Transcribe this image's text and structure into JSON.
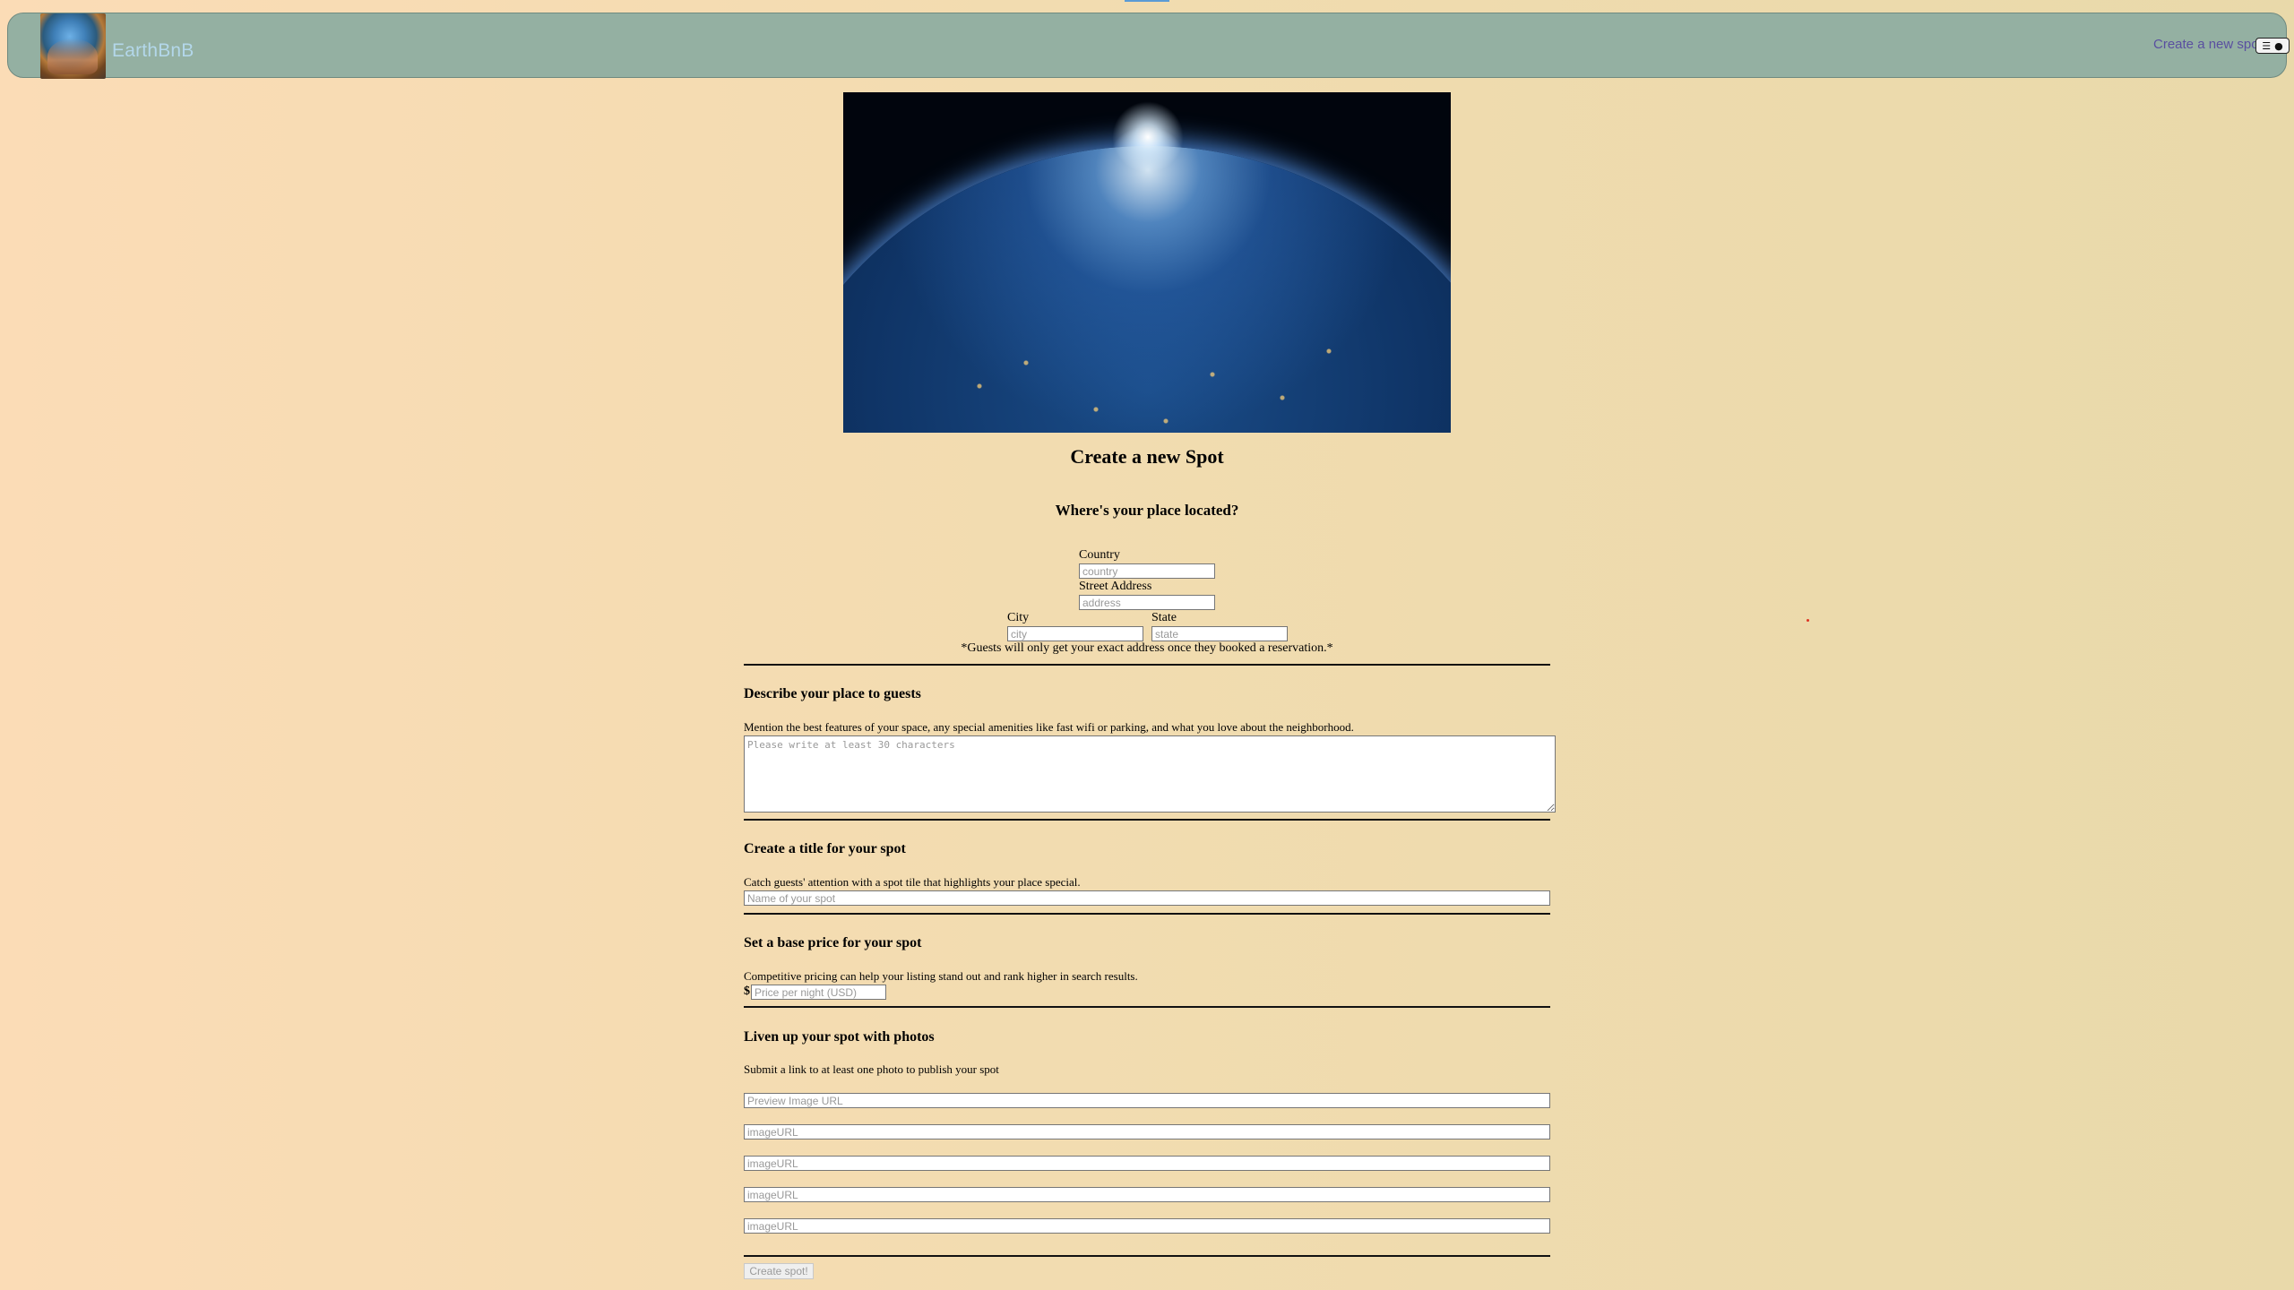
{
  "navbar": {
    "brand": "EarthBnB",
    "create_link": "Create a new spot",
    "menu_icon": "hamburger-icon",
    "user_icon": "user-circle-icon"
  },
  "form": {
    "title": "Create a new Spot",
    "location": {
      "heading": "Where's your place located?",
      "country_label": "Country",
      "country_placeholder": "country",
      "address_label": "Street Address",
      "address_placeholder": "address",
      "city_label": "City",
      "city_placeholder": "city",
      "state_label": "State",
      "state_placeholder": "state",
      "note": "*Guests will only get your exact address once they booked a reservation.*"
    },
    "description": {
      "heading": "Describe your place to guests",
      "text": "Mention the best features of your space, any special amenities like fast wifi or parking, and what you love about the neighborhood.",
      "placeholder": "Please write at least 30 characters"
    },
    "title_section": {
      "heading": "Create a title for your spot",
      "text": "Catch guests' attention with a spot tile that highlights your place special.",
      "placeholder": "Name of your spot"
    },
    "price": {
      "heading": "Set a base price for your spot",
      "text": "Competitive pricing can help your listing stand out and rank higher in search results.",
      "currency_symbol": "$",
      "placeholder": "Price per night (USD)"
    },
    "photos": {
      "heading": "Liven up your spot with photos",
      "text": "Submit a link to at least one photo to publish your spot",
      "preview_placeholder": "Preview Image URL",
      "image_placeholder_1": "imageURL",
      "image_placeholder_2": "imageURL",
      "image_placeholder_3": "imageURL",
      "image_placeholder_4": "imageURL"
    },
    "submit_label": "Create spot!"
  },
  "colors": {
    "navbar_bg": "#94b0a2",
    "brand_text": "#b3d7ea",
    "link": "#5a4fa0",
    "page_bg_left": "#fbdcb6",
    "page_bg_right": "#e9d9aa"
  }
}
